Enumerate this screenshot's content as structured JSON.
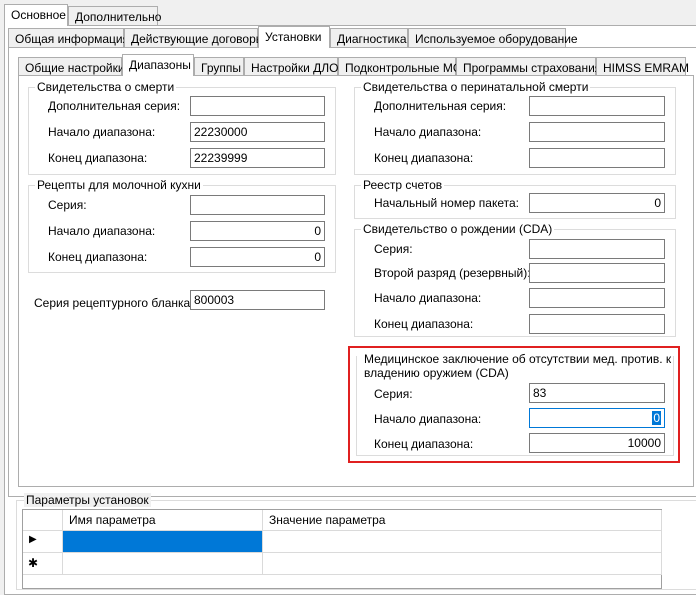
{
  "tabs_l1": [
    {
      "label": "Основное"
    },
    {
      "label": "Дополнительно"
    }
  ],
  "tabs_l2": [
    {
      "label": "Общая информация"
    },
    {
      "label": "Действующие договоры"
    },
    {
      "label": "Установки"
    },
    {
      "label": "Диагностика"
    },
    {
      "label": "Используемое оборудование"
    }
  ],
  "tabs_l3": [
    {
      "label": "Общие настройки"
    },
    {
      "label": "Диапазоны"
    },
    {
      "label": "Группы"
    },
    {
      "label": "Настройки ДЛО"
    },
    {
      "label": "Подконтрольные МО"
    },
    {
      "label": "Программы страхования"
    },
    {
      "label": "HIMSS EMRAM"
    }
  ],
  "death": {
    "title": "Свидетельства о смерти",
    "rows": [
      {
        "label": "Дополнительная серия:",
        "value": ""
      },
      {
        "label": "Начало диапазона:",
        "value": "22230000"
      },
      {
        "label": "Конец диапазона:",
        "value": "22239999"
      }
    ]
  },
  "perinatal": {
    "title": "Свидетельства о перинатальной смерти",
    "rows": [
      {
        "label": "Дополнительная серия:",
        "value": ""
      },
      {
        "label": "Начало диапазона:",
        "value": ""
      },
      {
        "label": "Конец диапазона:",
        "value": ""
      }
    ]
  },
  "milk": {
    "title": "Рецепты для молочной кухни",
    "rows": [
      {
        "label": "Серия:",
        "value": ""
      },
      {
        "label": "Начало диапазона:",
        "value": "0"
      },
      {
        "label": "Конец диапазона:",
        "value": "0"
      }
    ]
  },
  "invoices": {
    "title": "Реестр счетов",
    "rows": [
      {
        "label": "Начальный номер пакета:",
        "value": "0"
      }
    ]
  },
  "birth": {
    "title": "Свидетельство о рождении (CDA)",
    "rows": [
      {
        "label": "Серия:",
        "value": ""
      },
      {
        "label": "Второй разряд (резервный):",
        "value": ""
      },
      {
        "label": "Начало диапазона:",
        "value": ""
      },
      {
        "label": "Конец диапазона:",
        "value": ""
      }
    ]
  },
  "prescription_series": {
    "label": "Серия рецептурного бланка:",
    "value": "800003"
  },
  "weapon": {
    "title_line1": "Медицинское заключение об отсутствии мед. против. к",
    "title_line2": "владению оружием (CDA)",
    "rows": [
      {
        "label": "Серия:",
        "value": "83"
      },
      {
        "label": "Начало диапазона:",
        "value": "0"
      },
      {
        "label": "Конец диапазона:",
        "value": "10000"
      }
    ],
    "highlight_color": "#e02020"
  },
  "params": {
    "title": "Параметры установок",
    "columns": [
      "Имя параметра",
      "Значение параметра"
    ],
    "row_indicators": [
      "▶",
      "✱"
    ]
  },
  "colors": {
    "selection": "#0078d7",
    "tab_border": "#adadad"
  }
}
